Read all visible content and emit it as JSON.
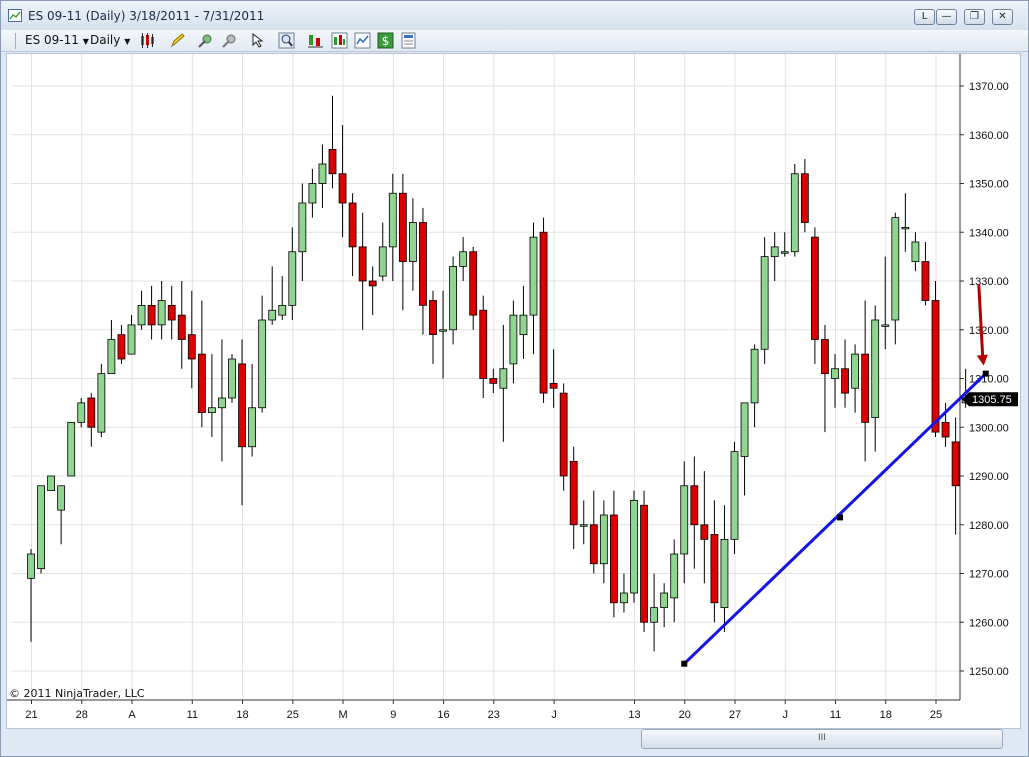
{
  "window": {
    "title": "ES 09-11 (Daily)  3/18/2011 - 7/31/2011",
    "buttons": {
      "layout": "L",
      "minimize": "—",
      "restore": "❐",
      "close": "✕"
    }
  },
  "toolbar": {
    "instrument": "ES 09-11",
    "interval": "Daily",
    "icons": [
      "candlestick-icon",
      "pencil-icon",
      "crosshair-icon",
      "pin-icon",
      "pointer-icon",
      "zoom-icon",
      "strategy-icon",
      "bars-icon",
      "chart-icon",
      "dollar-icon",
      "properties-icon"
    ]
  },
  "chart": {
    "copyright": "© 2011 NinjaTrader, LLC",
    "current_price_label": "1305.75",
    "current_price": 1305.75,
    "colors": {
      "up": "#8fd48f",
      "down": "#dd0000",
      "trendline": "#1414e6",
      "arrow": "#b40000",
      "grid": "#e3e3e3"
    }
  },
  "chart_data": {
    "type": "candlestick",
    "ylim": [
      1243,
      1375
    ],
    "y_ticks": [
      "1250.00",
      "1260.00",
      "1270.00",
      "1280.00",
      "1290.00",
      "1300.00",
      "1310.00",
      "1320.00",
      "1330.00",
      "1340.00",
      "1350.00",
      "1360.00",
      "1370.00"
    ],
    "x_ticks": [
      {
        "label": "21",
        "index": 0
      },
      {
        "label": "28",
        "index": 5
      },
      {
        "label": "A",
        "index": 10
      },
      {
        "label": "11",
        "index": 16
      },
      {
        "label": "18",
        "index": 21
      },
      {
        "label": "25",
        "index": 26
      },
      {
        "label": "M",
        "index": 31
      },
      {
        "label": "9",
        "index": 36
      },
      {
        "label": "16",
        "index": 41
      },
      {
        "label": "23",
        "index": 46
      },
      {
        "label": "J",
        "index": 52
      },
      {
        "label": "13",
        "index": 60
      },
      {
        "label": "20",
        "index": 65
      },
      {
        "label": "27",
        "index": 70
      },
      {
        "label": "J",
        "index": 75
      },
      {
        "label": "11",
        "index": 80
      },
      {
        "label": "18",
        "index": 85
      },
      {
        "label": "25",
        "index": 90
      }
    ],
    "ohlc": [
      [
        1269,
        1274,
        1256,
        1275
      ],
      [
        1271,
        1288,
        1270,
        1288
      ],
      [
        1287,
        1290,
        1283,
        1283
      ],
      [
        1283,
        1288,
        1276,
        1287
      ],
      [
        1290,
        1301,
        1290,
        1301
      ],
      [
        1301,
        1305,
        1300,
        1306
      ],
      [
        1306,
        1300,
        1296,
        1307
      ],
      [
        1299,
        1311,
        1298,
        1313
      ],
      [
        1311,
        1318,
        1311,
        1322
      ],
      [
        1319,
        1314,
        1313,
        1321
      ],
      [
        1315,
        1321,
        1315,
        1323
      ],
      [
        1321,
        1325,
        1320,
        1328
      ],
      [
        1325,
        1321,
        1318,
        1329
      ],
      [
        1321,
        1326,
        1318,
        1330
      ],
      [
        1325,
        1322,
        1318,
        1329
      ],
      [
        1323,
        1318,
        1312,
        1330
      ],
      [
        1319,
        1314,
        1308,
        1328
      ],
      [
        1315,
        1303,
        1300,
        1326
      ],
      [
        1303,
        1304,
        1298,
        1315
      ],
      [
        1304,
        1306,
        1293,
        1318
      ],
      [
        1306,
        1314,
        1305,
        1315
      ],
      [
        1313,
        1296,
        1284,
        1318
      ],
      [
        1296,
        1304,
        1294,
        1313
      ],
      [
        1304,
        1322,
        1303,
        1327
      ],
      [
        1322,
        1324,
        1321,
        1333
      ],
      [
        1323,
        1325,
        1322,
        1331
      ],
      [
        1325,
        1336,
        1322,
        1341
      ],
      [
        1336,
        1346,
        1330,
        1350
      ],
      [
        1346,
        1350,
        1343,
        1353
      ],
      [
        1350,
        1354,
        1345,
        1358
      ],
      [
        1357,
        1352,
        1349,
        1368
      ],
      [
        1352,
        1346,
        1339,
        1362
      ],
      [
        1346,
        1337,
        1331,
        1348
      ],
      [
        1337,
        1330,
        1320,
        1344
      ],
      [
        1330,
        1329,
        1323,
        1333
      ],
      [
        1331,
        1337,
        1330,
        1342
      ],
      [
        1337,
        1348,
        1330,
        1352
      ],
      [
        1348,
        1334,
        1324,
        1352
      ],
      [
        1334,
        1342,
        1328,
        1347
      ],
      [
        1342,
        1325,
        1319,
        1345
      ],
      [
        1326,
        1319,
        1313,
        1328
      ],
      [
        1320,
        1320,
        1310,
        1328
      ],
      [
        1320,
        1333,
        1317,
        1335
      ],
      [
        1333,
        1336,
        1330,
        1339
      ],
      [
        1336,
        1323,
        1320,
        1337
      ],
      [
        1324,
        1310,
        1306,
        1327
      ],
      [
        1310,
        1309,
        1307,
        1312
      ],
      [
        1308,
        1312,
        1297,
        1321
      ],
      [
        1313,
        1323,
        1309,
        1326
      ],
      [
        1319,
        1323,
        1314,
        1329
      ],
      [
        1323,
        1339,
        1315,
        1342
      ],
      [
        1340,
        1307,
        1305,
        1343
      ],
      [
        1309,
        1308,
        1304,
        1316
      ],
      [
        1307,
        1290,
        1287,
        1309
      ],
      [
        1293,
        1280,
        1275,
        1296
      ],
      [
        1280,
        1280,
        1276,
        1285
      ],
      [
        1280,
        1272,
        1270,
        1287
      ],
      [
        1272,
        1282,
        1268,
        1285
      ],
      [
        1282,
        1264,
        1261,
        1287
      ],
      [
        1264,
        1266,
        1262,
        1270
      ],
      [
        1266,
        1285,
        1264,
        1287
      ],
      [
        1284,
        1260,
        1258,
        1287
      ],
      [
        1260,
        1263,
        1254,
        1270
      ],
      [
        1263,
        1266,
        1259,
        1268
      ],
      [
        1265,
        1274,
        1260,
        1277
      ],
      [
        1274,
        1288,
        1268,
        1293
      ],
      [
        1288,
        1280,
        1271,
        1294
      ],
      [
        1280,
        1277,
        1268,
        1291
      ],
      [
        1278,
        1264,
        1260,
        1285
      ],
      [
        1263,
        1277,
        1258,
        1284
      ],
      [
        1277,
        1295,
        1274,
        1297
      ],
      [
        1294,
        1305,
        1286,
        1305
      ],
      [
        1305,
        1316,
        1300,
        1317
      ],
      [
        1316,
        1335,
        1313,
        1339
      ],
      [
        1335,
        1337,
        1330,
        1340
      ],
      [
        1336,
        1336,
        1335,
        1340
      ],
      [
        1336,
        1352,
        1335,
        1354
      ],
      [
        1352,
        1342,
        1340,
        1355
      ],
      [
        1339,
        1318,
        1313,
        1341
      ],
      [
        1318,
        1311,
        1299,
        1321
      ],
      [
        1310,
        1312,
        1304,
        1315
      ],
      [
        1312,
        1307,
        1304,
        1318
      ],
      [
        1308,
        1315,
        1303,
        1317
      ],
      [
        1315,
        1301,
        1293,
        1326
      ],
      [
        1302,
        1322,
        1295,
        1325
      ],
      [
        1321,
        1321,
        1316,
        1335
      ],
      [
        1322,
        1343,
        1317,
        1344
      ],
      [
        1341,
        1341,
        1336,
        1348
      ],
      [
        1334,
        1338,
        1332,
        1340
      ],
      [
        1334,
        1326,
        1325,
        1338
      ],
      [
        1326,
        1299,
        1298,
        1330
      ],
      [
        1301,
        1298,
        1296,
        1305
      ],
      [
        1297,
        1288,
        1278,
        1302
      ],
      [
        1305,
        1306,
        1304,
        1312
      ]
    ],
    "trendline": {
      "x": [
        65,
        80.5,
        95
      ],
      "y": [
        1251.5,
        1281.5,
        1311
      ]
    }
  }
}
